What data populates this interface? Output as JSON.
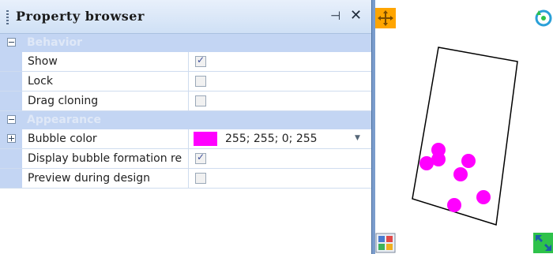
{
  "panel": {
    "title": "Property browser",
    "pin_glyph": "⊣",
    "close_glyph": "✕"
  },
  "categories": {
    "behavior": "Behavior",
    "appearance": "Appearance"
  },
  "properties": {
    "show": {
      "label": "Show",
      "checked": true
    },
    "lock": {
      "label": "Lock",
      "checked": false
    },
    "drag_cloning": {
      "label": "Drag cloning",
      "checked": false
    },
    "bubble_color": {
      "label": "Bubble color",
      "value": "255; 255; 0; 255",
      "swatch": "#ff00ff"
    },
    "display_bubble": {
      "label": "Display bubble formation re",
      "checked": true
    },
    "preview": {
      "label": "Preview during design",
      "checked": false
    }
  },
  "colors": {
    "bubble": "#ff00ff",
    "category_bg": "#c3d5f3",
    "move_tool": "#ffa500"
  },
  "icons": [
    "grip-icon",
    "pin-icon",
    "close-icon",
    "expand-icon",
    "checkbox-icon",
    "dropdown-arrow-icon",
    "move-icon",
    "rotate-icon",
    "grid-icon",
    "scale-icon"
  ]
}
